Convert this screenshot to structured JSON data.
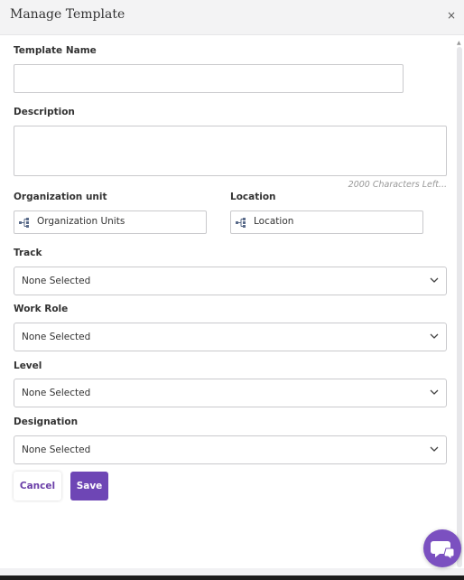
{
  "dialog": {
    "title": "Manage Template",
    "close": "×"
  },
  "fields": {
    "template_name": {
      "label": "Template Name",
      "value": ""
    },
    "description": {
      "label": "Description",
      "value": "",
      "counter": "2000 Characters Left..."
    },
    "org_unit": {
      "label": "Organization unit",
      "value": "Organization Units",
      "icon": "hierarchy-icon"
    },
    "location": {
      "label": "Location",
      "value": "Location",
      "icon": "hierarchy-icon"
    },
    "track": {
      "label": "Track",
      "value": "None Selected"
    },
    "work_role": {
      "label": "Work Role",
      "value": "None Selected"
    },
    "level": {
      "label": "Level",
      "value": "None Selected"
    },
    "designation": {
      "label": "Designation",
      "value": "None Selected"
    }
  },
  "buttons": {
    "cancel": "Cancel",
    "save": "Save"
  },
  "colors": {
    "accent": "#6e46b5",
    "chat": "#7b50c0"
  },
  "chat_widget": {
    "icon": "chat-bubbles-icon"
  }
}
